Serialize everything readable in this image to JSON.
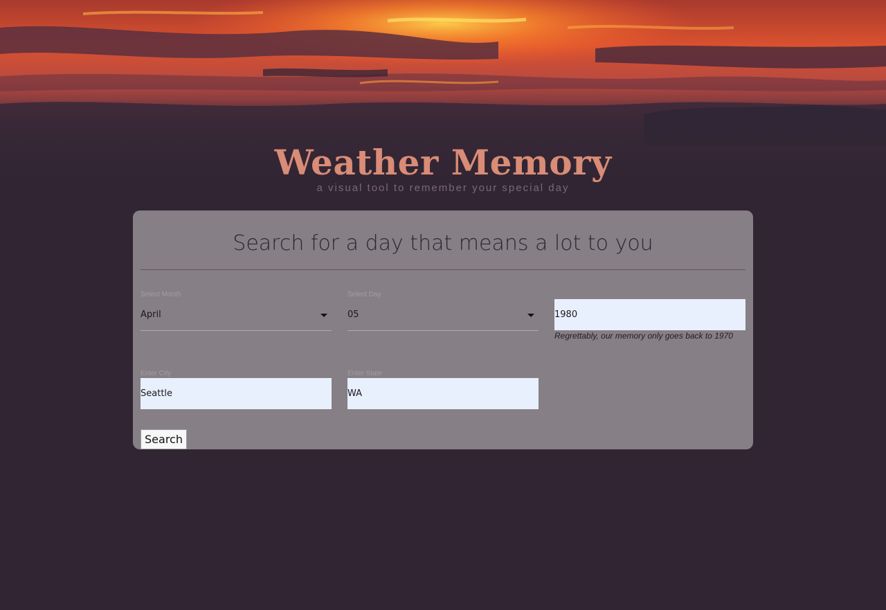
{
  "header": {
    "title": "Weather Memory",
    "subtitle": "a visual tool to remember your special day"
  },
  "form": {
    "heading": "Search for a day that means a lot to you",
    "month": {
      "label": "Select Month",
      "value": "April"
    },
    "day": {
      "label": "Select Day",
      "value": "05"
    },
    "year": {
      "value": "1980",
      "hint": "Regrettably, our memory only goes back to 1970"
    },
    "city": {
      "label": "Enter City",
      "value": "Seattle"
    },
    "state": {
      "label": "Enter State",
      "value": "WA"
    },
    "search_label": "Search"
  },
  "colors": {
    "background": "#312533",
    "title": "#d98c76",
    "card": "#867f86",
    "input_fill": "#e8f0fe"
  }
}
